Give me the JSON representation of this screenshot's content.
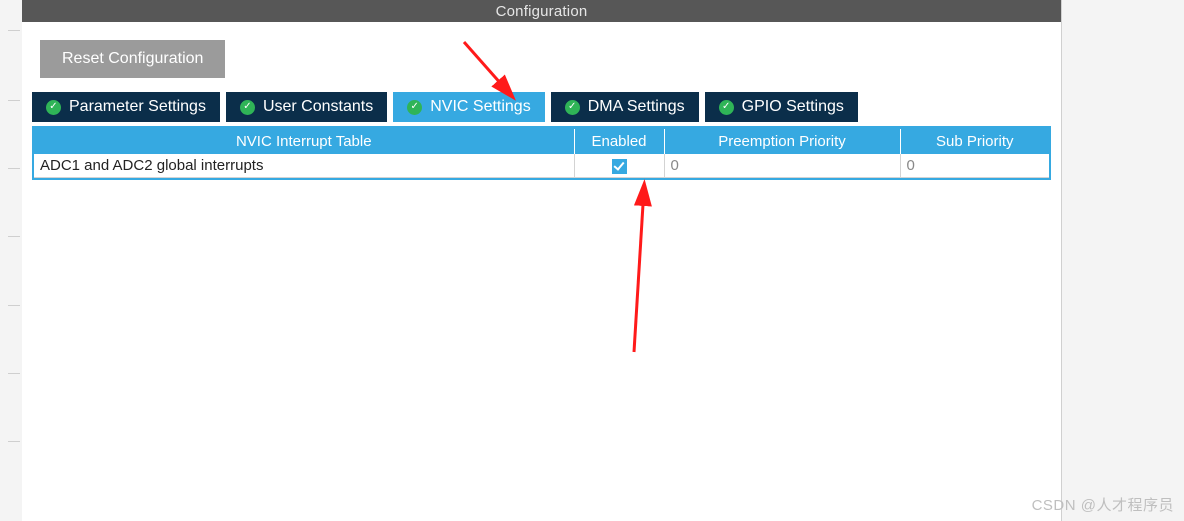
{
  "header": {
    "title": "Configuration"
  },
  "toolbar": {
    "reset_label": "Reset Configuration"
  },
  "tabs": [
    {
      "label": "Parameter Settings",
      "active": false
    },
    {
      "label": "User Constants",
      "active": false
    },
    {
      "label": "NVIC Settings",
      "active": true
    },
    {
      "label": "DMA Settings",
      "active": false
    },
    {
      "label": "GPIO Settings",
      "active": false
    }
  ],
  "nvic_table": {
    "columns": [
      "NVIC Interrupt Table",
      "Enabled",
      "Preemption Priority",
      "Sub Priority"
    ],
    "rows": [
      {
        "name": "ADC1 and ADC2 global interrupts",
        "enabled": true,
        "preemption": "0",
        "sub": "0"
      }
    ]
  },
  "watermark": "CSDN @人才程序员"
}
